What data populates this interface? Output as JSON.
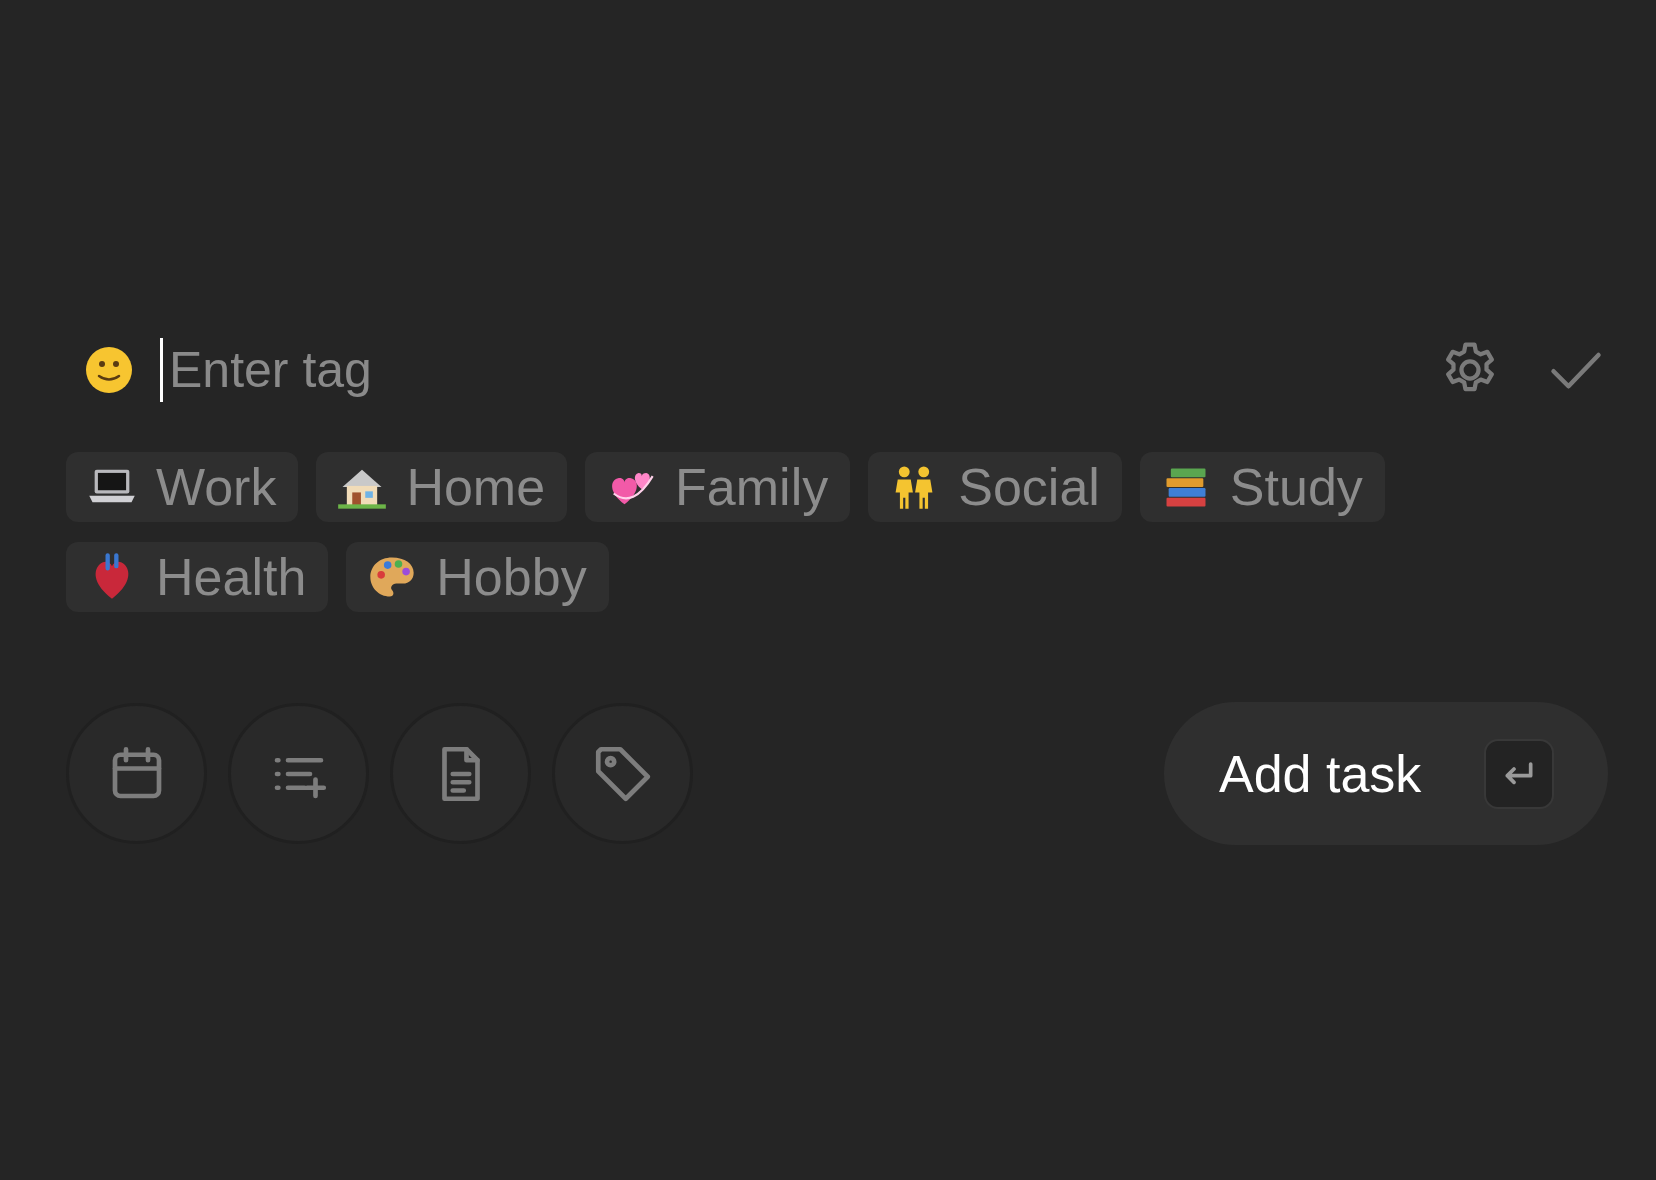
{
  "tag_input": {
    "placeholder": "Enter tag"
  },
  "tags": [
    {
      "kind": "laptop",
      "label": "Work"
    },
    {
      "kind": "house",
      "label": "Home"
    },
    {
      "kind": "hearts",
      "label": "Family"
    },
    {
      "kind": "people",
      "label": "Social"
    },
    {
      "kind": "books",
      "label": "Study"
    },
    {
      "kind": "heart",
      "label": "Health"
    },
    {
      "kind": "palette",
      "label": "Hobby"
    }
  ],
  "tools": [
    {
      "kind": "calendar"
    },
    {
      "kind": "list-add"
    },
    {
      "kind": "document"
    },
    {
      "kind": "tag"
    }
  ],
  "add_button": {
    "label": "Add task"
  }
}
